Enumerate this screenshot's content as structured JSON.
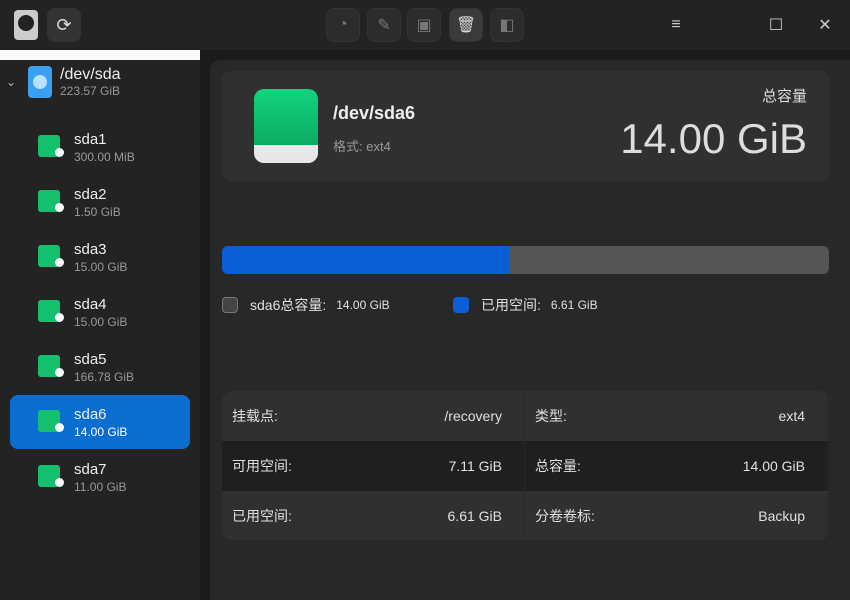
{
  "app": {
    "logo": "harddisk-app-icon"
  },
  "toolbar": {
    "buttons": [
      {
        "name": "partition-icon"
      },
      {
        "name": "wipe-icon"
      },
      {
        "name": "mount-icon"
      },
      {
        "name": "delete-icon"
      },
      {
        "name": "resize-icon"
      }
    ]
  },
  "disk": {
    "name": "/dev/sda",
    "size": "223.57 GiB"
  },
  "partitions": [
    {
      "name": "sda1",
      "size": "300.00 MiB"
    },
    {
      "name": "sda2",
      "size": "1.50 GiB"
    },
    {
      "name": "sda3",
      "size": "15.00 GiB"
    },
    {
      "name": "sda4",
      "size": "15.00 GiB"
    },
    {
      "name": "sda5",
      "size": "166.78 GiB"
    },
    {
      "name": "sda6",
      "size": "14.00 GiB"
    },
    {
      "name": "sda7",
      "size": "11.00 GiB"
    }
  ],
  "selected": {
    "name": "/dev/sda6",
    "format": "格式: ext4",
    "capacity_label": "总容量",
    "capacity": "14.00 GiB"
  },
  "usage": {
    "used_fraction": 0.472,
    "total_label": "sda6总容量:",
    "total": "14.00 GiB",
    "used_label": "已用空间:",
    "used": "6.61 GiB",
    "used_color": "#0a5fd6",
    "free_color": "#555555"
  },
  "info": [
    [
      {
        "label": "挂载点:",
        "value": "/recovery"
      },
      {
        "label": "类型:",
        "value": "ext4"
      }
    ],
    [
      {
        "label": "可用空间:",
        "value": "7.11 GiB"
      },
      {
        "label": "总容量:",
        "value": "14.00 GiB"
      }
    ],
    [
      {
        "label": "已用空间:",
        "value": "6.61 GiB"
      },
      {
        "label": "分卷卷标:",
        "value": "Backup"
      }
    ]
  ]
}
